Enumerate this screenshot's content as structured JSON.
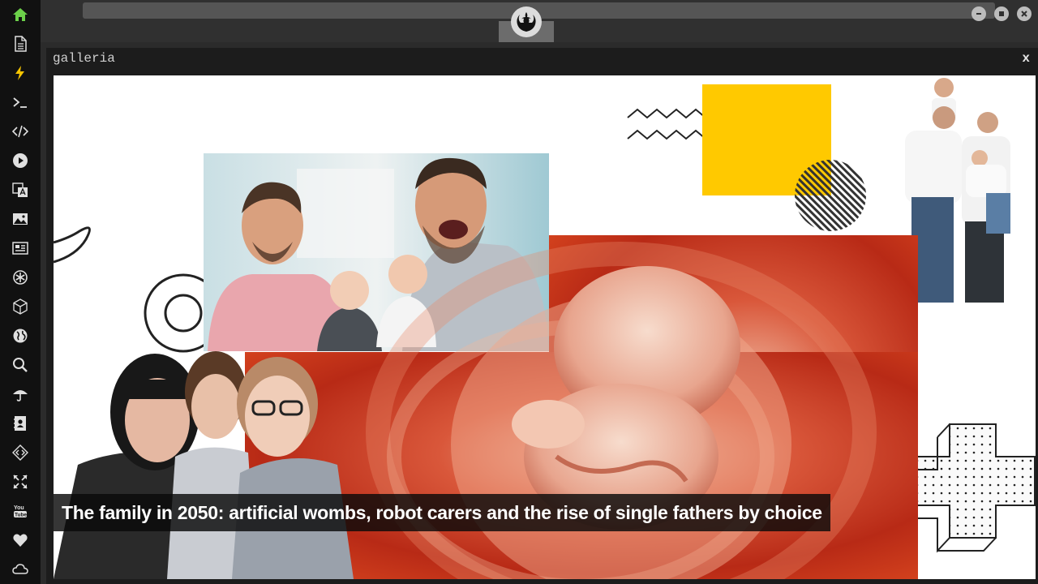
{
  "sidebar": {
    "items": [
      {
        "icon": "home-icon",
        "color": "#6cd04a"
      },
      {
        "icon": "document-icon"
      },
      {
        "icon": "lightning-icon",
        "color": "#f5c400"
      },
      {
        "icon": "terminal-icon"
      },
      {
        "icon": "code-icon"
      },
      {
        "icon": "play-icon"
      },
      {
        "icon": "translate-icon"
      },
      {
        "icon": "image-icon"
      },
      {
        "icon": "news-icon"
      },
      {
        "icon": "settings-icon"
      },
      {
        "icon": "cube-icon"
      },
      {
        "icon": "globe-icon"
      },
      {
        "icon": "search-icon"
      },
      {
        "icon": "umbrella-icon"
      },
      {
        "icon": "contacts-icon"
      },
      {
        "icon": "diamond-code-icon"
      },
      {
        "icon": "expand-icon"
      },
      {
        "icon": "youtube-icon"
      },
      {
        "icon": "heart-icon"
      },
      {
        "icon": "cloud-icon"
      }
    ]
  },
  "window": {
    "title": "galleria",
    "close_label": "x"
  },
  "gallery": {
    "caption": "The family in 2050: artificial wombs, robot carers and the rise of single fathers by choice"
  },
  "colors": {
    "accent_green": "#6cd04a",
    "accent_yellow": "#f5c400"
  }
}
